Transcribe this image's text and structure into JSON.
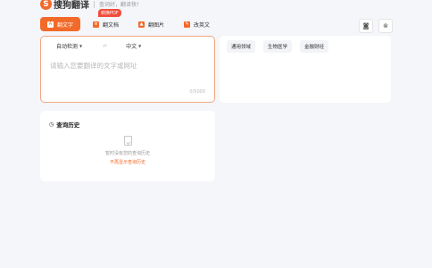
{
  "brand": {
    "logo_glyph": "S",
    "name": "搜狗翻译",
    "slogan": "查词好，翻译快！"
  },
  "tabs": [
    {
      "label": "翻文字",
      "icon": "text-icon",
      "active": true
    },
    {
      "label": "翻文档",
      "icon": "document-icon",
      "badge": "转换PDF"
    },
    {
      "label": "翻图片",
      "icon": "image-icon"
    },
    {
      "label": "改英文",
      "icon": "edit-icon"
    }
  ],
  "toolbar": {
    "screenshot_icon": "camera-icon",
    "settings_icon": "settings-icon"
  },
  "source": {
    "from_lang": "自动检测",
    "to_lang": "中文",
    "swap_symbol": "⇌",
    "placeholder": "请输入您要翻译的文字或网址",
    "counter": "0/5000"
  },
  "target": {
    "domains": [
      "通用领域",
      "生物医学",
      "金融财经"
    ]
  },
  "history": {
    "title": "查询历史",
    "empty_text": "暂时没有您的查询历史",
    "toggle_label": "不再显示查询历史"
  },
  "colors": {
    "accent": "#f26a2a",
    "badge": "#f04c3b",
    "background": "#f5f6fa"
  }
}
